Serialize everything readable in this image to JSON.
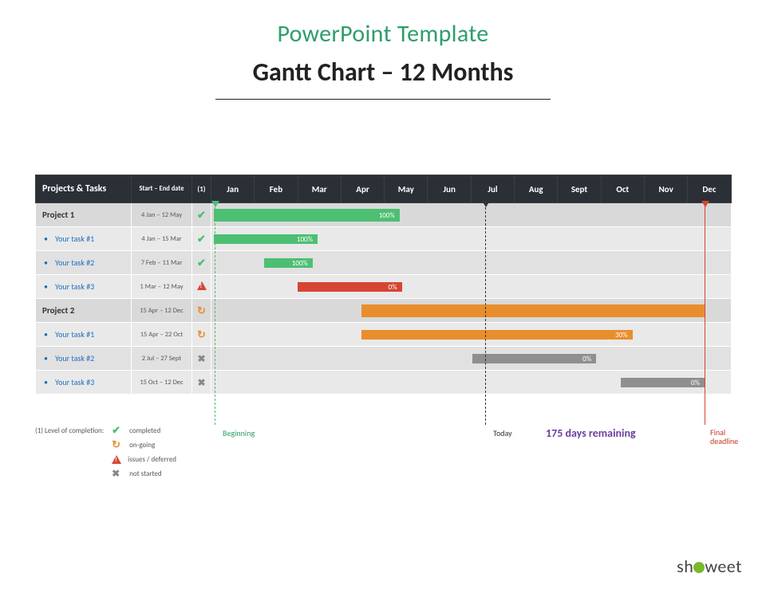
{
  "titles": {
    "sub": "PowerPoint Template",
    "main": "Gantt Chart – 12 Months"
  },
  "header": {
    "name": "Projects & Tasks",
    "dates": "Start – End date",
    "status": "(1)"
  },
  "months": [
    "Jan",
    "Feb",
    "Mar",
    "Apr",
    "May",
    "Jun",
    "Jul",
    "Aug",
    "Sept",
    "Oct",
    "Nov",
    "Dec"
  ],
  "rows": [
    {
      "type": "project",
      "name": "Project 1",
      "dates": "4 Jan – 12 May",
      "status": "completed"
    },
    {
      "type": "task",
      "name": "Your task #1",
      "dates": "4 Jan – 15 Mar",
      "status": "completed"
    },
    {
      "type": "task",
      "name": "Your task #2",
      "dates": "7 Feb – 11 Mar",
      "status": "completed"
    },
    {
      "type": "task",
      "name": "Your task #3",
      "dates": "1 Mar – 12 May",
      "status": "issues"
    },
    {
      "type": "project",
      "name": "Project 2",
      "dates": "15 Apr – 12 Dec",
      "status": "ongoing"
    },
    {
      "type": "task",
      "name": "Your task #1",
      "dates": "15 Apr – 22 Oct",
      "status": "ongoing"
    },
    {
      "type": "task",
      "name": "Your task #2",
      "dates": "2 Jul – 27 Sept",
      "status": "notstarted"
    },
    {
      "type": "task",
      "name": "Your task #3",
      "dates": "15 Oct – 12 Dec",
      "status": "notstarted"
    }
  ],
  "pct": {
    "p1": "100%",
    "t1": "100%",
    "t2": "100%",
    "t3": "0%",
    "t5": "30%",
    "t6": "0%",
    "t7": "0%"
  },
  "markers": {
    "beginning": "Beginning",
    "today": "Today",
    "final": "Final\ndeadline",
    "remaining": "175 days remaining"
  },
  "legend": {
    "title": "(1) Level of completion:",
    "items": {
      "completed": "completed",
      "ongoing": "on-going",
      "issues": "issues / deferred",
      "notstarted": "not started"
    }
  },
  "logo": {
    "pre": "sh",
    "post": "weet"
  },
  "chart_data": {
    "type": "gantt",
    "title": "Gantt Chart – 12 Months",
    "x_categories": [
      "Jan",
      "Feb",
      "Mar",
      "Apr",
      "May",
      "Jun",
      "Jul",
      "Aug",
      "Sept",
      "Oct",
      "Nov",
      "Dec"
    ],
    "markers": [
      {
        "name": "Beginning",
        "x": 0.1
      },
      {
        "name": "Today",
        "x": 6.33
      },
      {
        "name": "Final deadline",
        "x": 11.4
      }
    ],
    "series": [
      {
        "name": "Project 1",
        "parent": null,
        "start": 0.1,
        "end": 4.4,
        "percent": 100,
        "status": "completed",
        "color": "#4cbf73"
      },
      {
        "name": "Your task #1",
        "parent": "Project 1",
        "start": 0.1,
        "end": 2.5,
        "percent": 100,
        "status": "completed",
        "color": "#4cbf73"
      },
      {
        "name": "Your task #2",
        "parent": "Project 1",
        "start": 1.23,
        "end": 2.35,
        "percent": 100,
        "status": "completed",
        "color": "#4cbf73"
      },
      {
        "name": "Your task #3",
        "parent": "Project 1",
        "start": 2.0,
        "end": 4.4,
        "percent": 0,
        "status": "issues",
        "color": "#d64533"
      },
      {
        "name": "Project 2",
        "parent": null,
        "start": 3.47,
        "end": 11.4,
        "percent": null,
        "status": "ongoing",
        "color": "#e98e2c"
      },
      {
        "name": "Your task #1",
        "parent": "Project 2",
        "start": 3.47,
        "end": 9.73,
        "percent": 30,
        "status": "ongoing",
        "color": "#e98e2c"
      },
      {
        "name": "Your task #2",
        "parent": "Project 2",
        "start": 6.03,
        "end": 8.9,
        "percent": 0,
        "status": "notstarted",
        "color": "#8f8f8f"
      },
      {
        "name": "Your task #3",
        "parent": "Project 2",
        "start": 9.47,
        "end": 11.4,
        "percent": 0,
        "status": "notstarted",
        "color": "#8f8f8f"
      }
    ]
  }
}
